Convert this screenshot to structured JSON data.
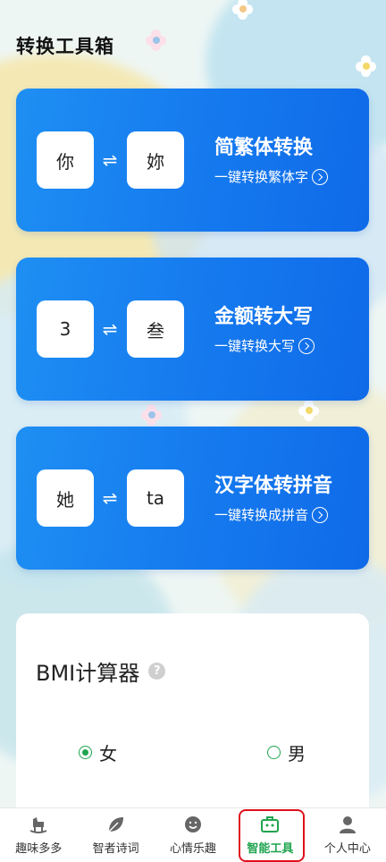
{
  "page": {
    "title": "转换工具箱"
  },
  "tools": [
    {
      "left_char": "你",
      "right_char": "妳",
      "swap_symbol": "⇌",
      "title": "简繁体转换",
      "subtitle": "一键转换繁体字"
    },
    {
      "left_char": "3",
      "right_char": "叁",
      "swap_symbol": "⇌",
      "title": "金额转大写",
      "subtitle": "一键转换大写"
    },
    {
      "left_char": "她",
      "right_char": "ta",
      "swap_symbol": "⇌",
      "title": "汉字体转拼音",
      "subtitle": "一键转换成拼音"
    }
  ],
  "bmi": {
    "title": "BMI计算器",
    "help_symbol": "?",
    "gender_options": [
      {
        "label": "女",
        "selected": true
      },
      {
        "label": "男",
        "selected": false
      }
    ]
  },
  "tabbar": {
    "items": [
      {
        "label": "趣味多多",
        "icon": "rocking-horse-icon",
        "active": false
      },
      {
        "label": "智者诗词",
        "icon": "leaf-icon",
        "active": false
      },
      {
        "label": "心情乐趣",
        "icon": "smile-icon",
        "active": false
      },
      {
        "label": "智能工具",
        "icon": "toolbox-icon",
        "active": true
      },
      {
        "label": "个人中心",
        "icon": "person-icon",
        "active": false
      }
    ]
  },
  "colors": {
    "accent_blue": "#1579ee",
    "accent_green": "#1fa44f",
    "highlight_red": "#e0101c"
  }
}
